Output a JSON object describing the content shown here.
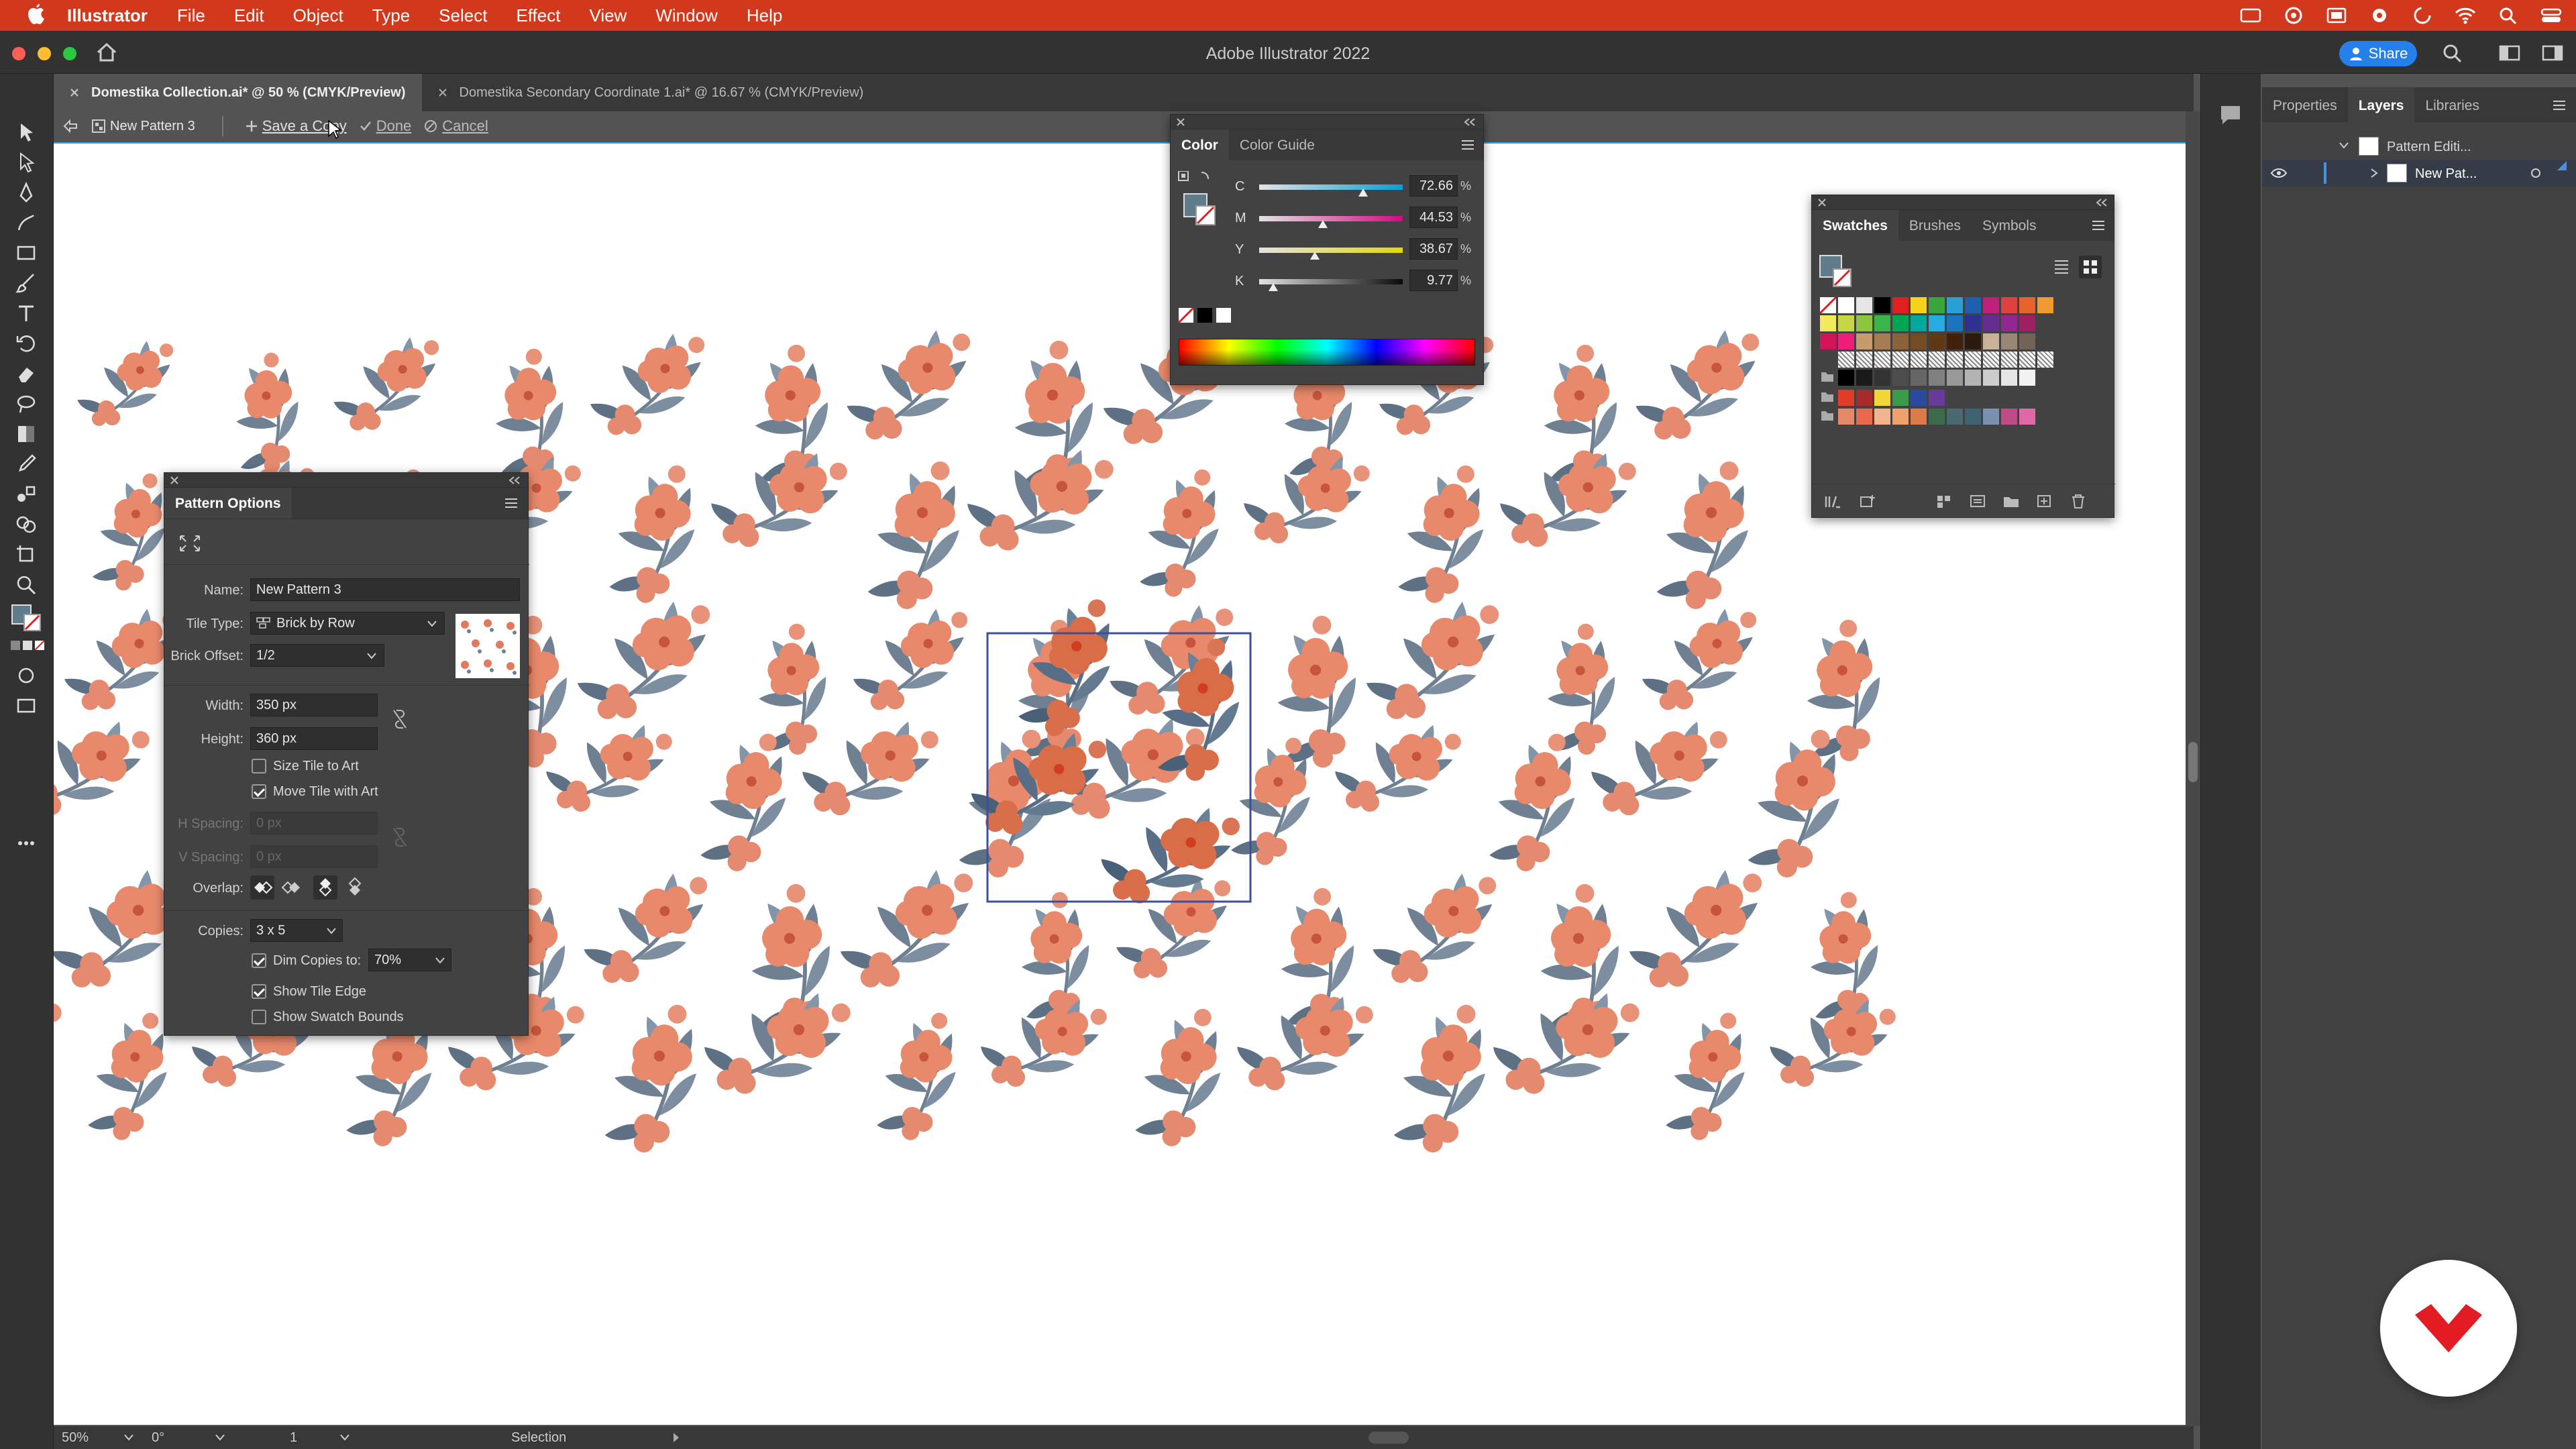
{
  "menubar": {
    "app_name": "Illustrator",
    "items": [
      "File",
      "Edit",
      "Object",
      "Type",
      "Select",
      "Effect",
      "View",
      "Window",
      "Help"
    ]
  },
  "window": {
    "title": "Adobe Illustrator 2022",
    "share_label": "Share"
  },
  "tabs": [
    {
      "label": "Domestika Collection.ai* @ 50 % (CMYK/Preview)",
      "active": true
    },
    {
      "label": "Domestika Secondary Coordinate 1.ai* @ 16.67 % (CMYK/Preview)",
      "active": false
    }
  ],
  "pattern_bar": {
    "pattern_name": "New Pattern 3",
    "save_copy": "Save a Copy",
    "done": "Done",
    "cancel": "Cancel"
  },
  "color_panel": {
    "tabs": [
      "Color",
      "Color Guide"
    ],
    "channels": [
      {
        "label": "C",
        "value": "72.66",
        "unit": "%",
        "fraction": 0.7266
      },
      {
        "label": "M",
        "value": "44.53",
        "unit": "%",
        "fraction": 0.4453
      },
      {
        "label": "Y",
        "value": "38.67",
        "unit": "%",
        "fraction": 0.3867
      },
      {
        "label": "K",
        "value": "9.77",
        "unit": "%",
        "fraction": 0.0977
      }
    ]
  },
  "swatches_panel": {
    "tabs": [
      "Swatches",
      "Brushes",
      "Symbols"
    ],
    "row1": [
      "#ffffff",
      "#e6e6e6",
      "#000000",
      "#e02020",
      "#f7d21b",
      "#3aa53a",
      "#2a9fd6",
      "#1f5fb0",
      "#c0207a",
      "#e04040",
      "#e8632b",
      "#f09a30"
    ],
    "row2": [
      "#f2ea5a",
      "#c8d645",
      "#8cc63f",
      "#39b54a",
      "#00a651",
      "#00a99d",
      "#27aae1",
      "#1c75bc",
      "#2e3192",
      "#662d91",
      "#92278f",
      "#9e1f63"
    ],
    "row3": [
      "#d4145a",
      "#ed1e79",
      "#c69c6d",
      "#a67c52",
      "#8c6239",
      "#754c24",
      "#603813",
      "#42210b",
      "#2b1a0e",
      "#c7b299",
      "#998675",
      "#736357"
    ],
    "gray_row": [
      "#000000",
      "#1a1a1a",
      "#333333",
      "#4d4d4d",
      "#666666",
      "#808080",
      "#999999",
      "#b3b3b3",
      "#cccccc",
      "#e6e6e6",
      "#f2f2f2"
    ],
    "group1": [
      "#e23b27",
      "#a82a2a",
      "#f2d633",
      "#3b9b4a",
      "#2b4aa0",
      "#6a3a9a"
    ],
    "group2": [
      "#e8886a",
      "#e76a4f",
      "#f2b38d",
      "#f0a06a",
      "#de7a4a",
      "#3c6a4a",
      "#4a6a72",
      "#3d6272",
      "#7a90b0",
      "#c04a8a",
      "#e068a8"
    ]
  },
  "pattern_options": {
    "title": "Pattern Options",
    "name_label": "Name:",
    "name_value": "New Pattern 3",
    "tile_type_label": "Tile Type:",
    "tile_type_value": "Brick by Row",
    "brick_offset_label": "Brick Offset:",
    "brick_offset_value": "1/2",
    "width_label": "Width:",
    "width_value": "350 px",
    "height_label": "Height:",
    "height_value": "360 px",
    "size_tile": "Size Tile to Art",
    "move_tile": "Move Tile with Art",
    "h_spacing_label": "H Spacing:",
    "h_spacing_value": "0 px",
    "v_spacing_label": "V Spacing:",
    "v_spacing_value": "0 px",
    "overlap_label": "Overlap:",
    "copies_label": "Copies:",
    "copies_value": "3 x 5",
    "dim_copies": "Dim Copies to:",
    "dim_value": "70%",
    "show_tile_edge": "Show Tile Edge",
    "show_swatch_bounds": "Show Swatch Bounds"
  },
  "right_panel": {
    "tabs": [
      "Properties",
      "Layers",
      "Libraries"
    ],
    "layer1": "Pattern Editi...",
    "layer2": "New Pat..."
  },
  "status": {
    "zoom": "50%",
    "rotation": "0°",
    "artboard": "1",
    "tool": "Selection"
  },
  "colors": {
    "menubar": "#d2391c",
    "accent": "#2680eb",
    "flower": "#e8896b",
    "flower_dark": "#d9553b",
    "leaf": "#6f8093",
    "leaf_dark": "#3e5565"
  }
}
